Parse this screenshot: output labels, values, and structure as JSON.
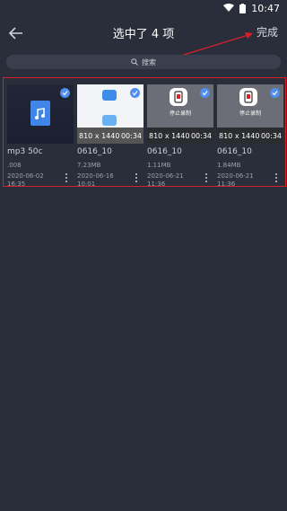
{
  "status_bar": {
    "time": "10:47"
  },
  "header": {
    "title": "选中了 4 项",
    "done_label": "完成"
  },
  "search": {
    "placeholder": "搜索"
  },
  "cards": [
    {
      "name": "mp3    50c",
      "size": ".008",
      "date": "2020-06-02\n16:35"
    },
    {
      "name": "0616_10",
      "size": "7.23MB",
      "date": "2020-06-16\n10:01",
      "resolution": "810 x 1440",
      "duration": "00:34"
    },
    {
      "name": "0616_10",
      "size": "1.11MB",
      "date": "2020-06-21\n11:36",
      "resolution": "810 x 1440",
      "duration": "00:34",
      "badge": "停止录制"
    },
    {
      "name": "0616_10",
      "size": "1.84MB",
      "date": "2020-06-21\n11:36",
      "resolution": "810 x 1440",
      "duration": "00:34",
      "badge": "停止录制"
    }
  ],
  "colors": {
    "background": "#2a2e3b",
    "accent": "#4f8ff0",
    "selection_border": "#d8202a"
  }
}
